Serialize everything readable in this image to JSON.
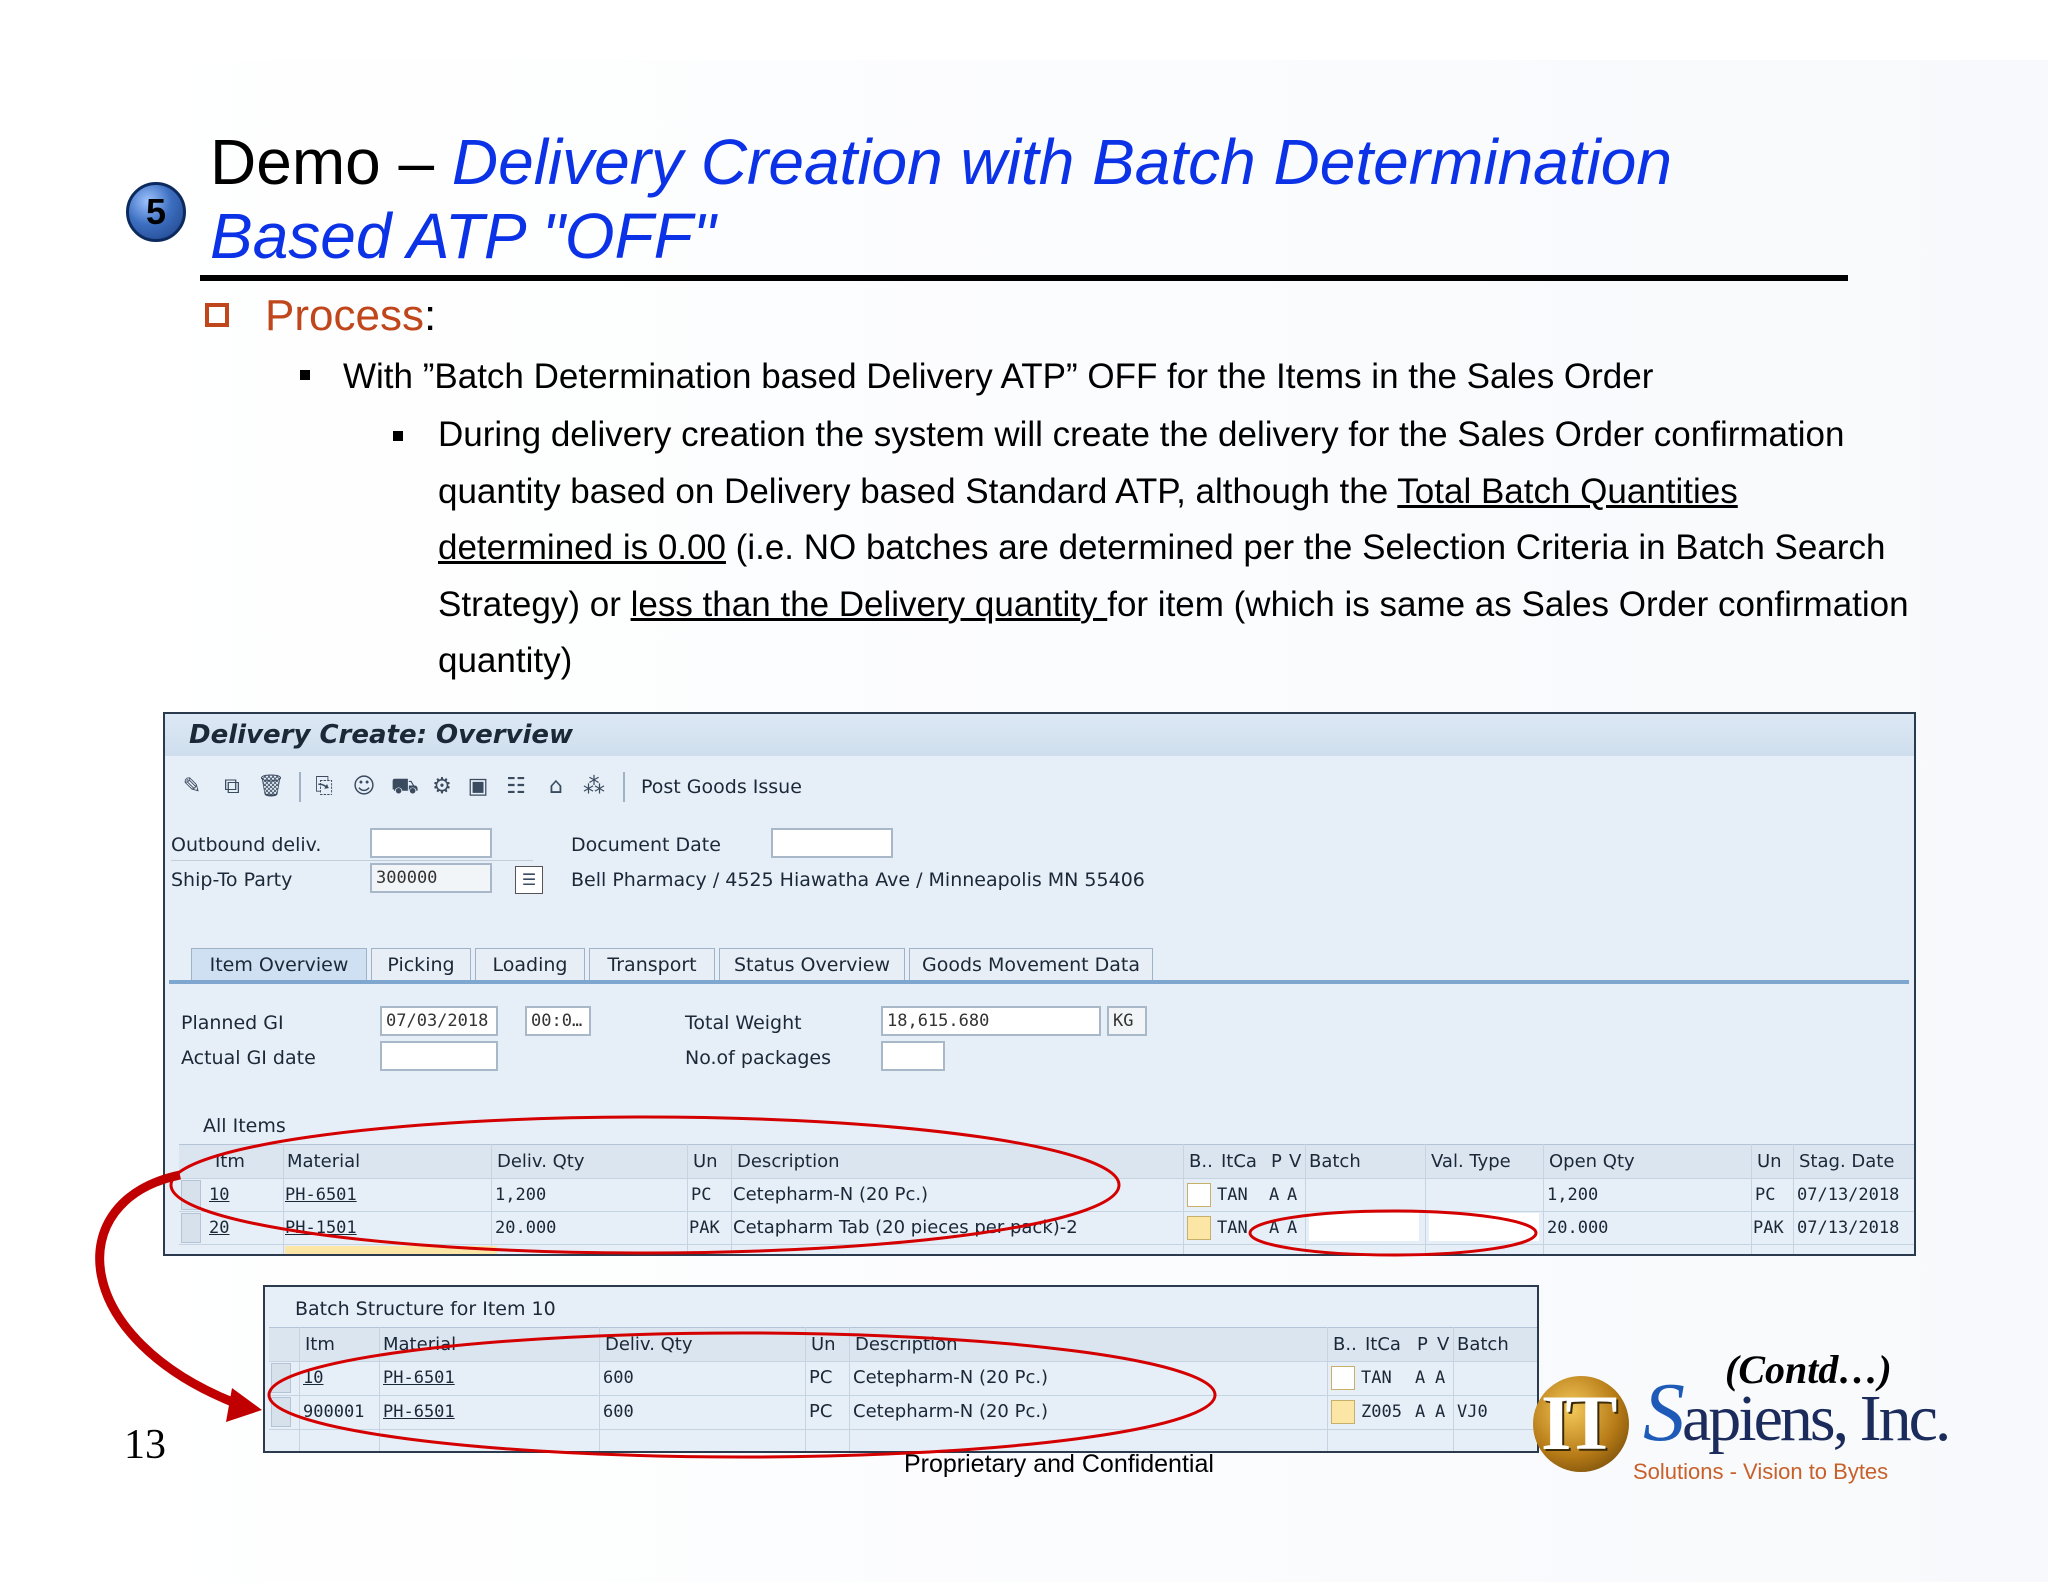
{
  "slide": {
    "step_number": "5",
    "title_plain": "Demo – ",
    "title_italic": "Delivery Creation with Batch Determination Based ATP \"OFF\"",
    "process_label": "Process",
    "process_colon": ":",
    "bullet1": "With ”Batch Determination based Delivery ATP” OFF for the Items in the Sales Order",
    "bullet2": {
      "part1": "During delivery creation the system will create the delivery for the Sales Order confirmation quantity based on Delivery based Standard ATP, although the ",
      "underline1": "Total Batch Quantities determined is 0.00",
      "part2": " (i.e. NO batches are determined per the Selection Criteria in Batch Search Strategy) or ",
      "underline2": "less than the Delivery quantity ",
      "part3": "for item (which is same as Sales Order confirmation quantity)"
    },
    "contd": "(Contd…)",
    "slide_number": "13",
    "footer": "Proprietary and Confidential",
    "logo": {
      "it": "IT",
      "sapiens_s": "S",
      "sapiens_rest": "apiens, Inc.",
      "tagline": "Solutions - Vision to Bytes"
    }
  },
  "sap_window": {
    "title": "Delivery  Create: Overview",
    "toolbar": {
      "icons": [
        "edit-icon",
        "copy-icon",
        "delete-icon",
        "document-flow-icon",
        "partner-icon",
        "truck-icon",
        "picking-icon",
        "packing-icon",
        "handling-units-icon",
        "warehouse-icon",
        "grid-icon"
      ],
      "post_goods_issue": "Post Goods Issue"
    },
    "header": {
      "outbound_label": "Outbound deliv.",
      "outbound_value": "",
      "doc_date_label": "Document Date",
      "doc_date_value": "",
      "shipto_label": "Ship-To Party",
      "shipto_value": "300000",
      "shipto_address": "Bell Pharmacy / 4525 Hiawatha Ave / Minneapolis MN 55406"
    },
    "tabs": [
      "Item Overview",
      "Picking",
      "Loading",
      "Transport",
      "Status Overview",
      "Goods Movement Data"
    ],
    "item_overview": {
      "planned_gi_label": "Planned GI",
      "planned_gi_date": "07/03/2018",
      "planned_gi_time": "00:0…",
      "actual_gi_label": "Actual GI date",
      "actual_gi_value": "",
      "total_weight_label": "Total Weight",
      "total_weight_value": "18,615.680",
      "total_weight_unit": "KG",
      "packages_label": "No.of packages",
      "packages_value": ""
    },
    "all_items": {
      "label": "All Items",
      "columns": [
        "Itm",
        "Material",
        "Deliv. Qty",
        "Un",
        "Description",
        "B..",
        "ItCa",
        "P",
        "V",
        "Batch",
        "Val. Type",
        "Open Qty",
        "Un",
        "Stag. Date"
      ],
      "rows": [
        {
          "itm": "10",
          "material": "PH-6501",
          "qty": "1,200",
          "un": "PC",
          "desc": "Cetepharm-N (20 Pc.)",
          "itca": "TAN",
          "p": "A",
          "v": "A",
          "batch": "",
          "valtype": "",
          "open_qty": "1,200",
          "open_un": "PC",
          "stag_date": "07/13/2018"
        },
        {
          "itm": "20",
          "material": "PH-1501",
          "qty": "20.000",
          "un": "PAK",
          "desc": "Cetapharm Tab (20 pieces per pack)-2",
          "itca": "TAN",
          "p": "A",
          "v": "A",
          "batch": "",
          "valtype": "",
          "open_qty": "20.000",
          "open_un": "PAK",
          "stag_date": "07/13/2018"
        }
      ]
    }
  },
  "batch_window": {
    "title": "Batch Structure for Item 10",
    "columns": [
      "Itm",
      "Material",
      "Deliv. Qty",
      "Un",
      "Description",
      "B..",
      "ItCa",
      "P",
      "V",
      "Batch"
    ],
    "rows": [
      {
        "itm": "10",
        "material": "PH-6501",
        "qty": "600",
        "un": "PC",
        "desc": "Cetepharm-N (20 Pc.)",
        "itca": "TAN",
        "p": "A",
        "v": "A",
        "batch": ""
      },
      {
        "itm": "900001",
        "material": "PH-6501",
        "qty": "600",
        "un": "PC",
        "desc": "Cetepharm-N (20 Pc.)",
        "itca": "Z005",
        "p": "A",
        "v": "A",
        "batch": "VJ0"
      }
    ]
  },
  "colors": {
    "title_blue": "#0b32e6",
    "process_orange": "#c0461b",
    "annotation_red": "#d40000"
  }
}
